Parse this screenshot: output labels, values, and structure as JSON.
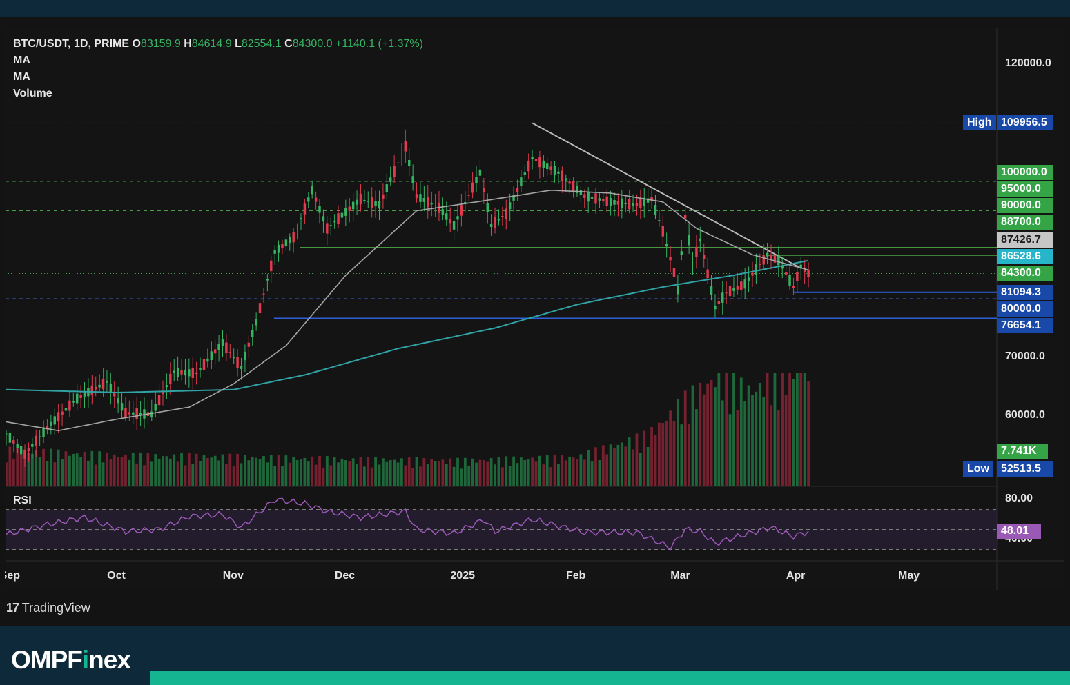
{
  "header": {
    "symbol": "BTC/USDT, 1D, PRIME",
    "o_key": "O",
    "o": "83159.9",
    "h_key": "H",
    "h": "84614.9",
    "l_key": "L",
    "l": "82554.1",
    "c_key": "C",
    "c": "84300.0",
    "change": "+1140.1 (+1.37%)",
    "indicators": [
      "MA",
      "MA",
      "Volume"
    ]
  },
  "rsi_label": "RSI",
  "branding": {
    "tradingview": "TradingView",
    "site_pre": "OMPF",
    "site_i": "i",
    "site_post": "nex"
  },
  "colors": {
    "up": "#35b463",
    "down": "#e03a4e",
    "ma_short": "#a5a5a5",
    "ma_long": "#2fa3a5",
    "rsi": "#9b59b6",
    "accent": "#15b592"
  },
  "chart_data": {
    "type": "candlestick",
    "symbol": "BTC/USDT",
    "interval": "1D",
    "x_labels": [
      "Sep",
      "Oct",
      "Nov",
      "Dec",
      "2025",
      "Feb",
      "Mar",
      "Apr",
      "May"
    ],
    "price_axis_ticks": [
      "120000.0",
      "70000.0",
      "60000.0"
    ],
    "price_range": [
      49000,
      125000
    ],
    "price_tags": [
      {
        "label": "High",
        "value": "109956.5",
        "style": "blue"
      },
      {
        "label": "",
        "value": "100000.0",
        "style": "green"
      },
      {
        "label": "",
        "value": "95000.0",
        "style": "green"
      },
      {
        "label": "",
        "value": "90000.0",
        "style": "green"
      },
      {
        "label": "",
        "value": "88700.0",
        "style": "green"
      },
      {
        "label": "",
        "value": "87426.7",
        "style": "grey"
      },
      {
        "label": "",
        "value": "86528.6",
        "style": "cyan"
      },
      {
        "label": "",
        "value": "84300.0",
        "style": "green"
      },
      {
        "label": "",
        "value": "81094.3",
        "style": "blue"
      },
      {
        "label": "",
        "value": "80000.0",
        "style": "blue"
      },
      {
        "label": "",
        "value": "76654.1",
        "style": "blue"
      },
      {
        "label": "",
        "value": "7.741K",
        "style": "green"
      },
      {
        "label": "Low",
        "value": "52513.5",
        "style": "blue"
      }
    ],
    "levels": [
      {
        "value": 100000,
        "style": "dashed-green"
      },
      {
        "value": 95000,
        "style": "dashed-green"
      },
      {
        "value": 88700,
        "style": "solid-green"
      },
      {
        "value": 87426.7,
        "style": "solid-green"
      },
      {
        "value": 84300,
        "style": "dotted-green"
      },
      {
        "value": 81094.3,
        "style": "solid-blue"
      },
      {
        "value": 80000,
        "style": "dashed-blue"
      },
      {
        "value": 76654.1,
        "style": "solid-blue"
      },
      {
        "value": 109956.5,
        "style": "dotted-blue"
      }
    ],
    "trendline": {
      "from": [
        "2025-01-20",
        109956.5
      ],
      "to": [
        "2025-04-02",
        85200
      ]
    },
    "ohlc_anchors": [
      [
        "2024-09-01",
        57000
      ],
      [
        "2024-09-06",
        53500
      ],
      [
        "2024-09-12",
        58000
      ],
      [
        "2024-09-20",
        63000
      ],
      [
        "2024-09-28",
        65800
      ],
      [
        "2024-10-03",
        60500
      ],
      [
        "2024-10-10",
        60300
      ],
      [
        "2024-10-16",
        67500
      ],
      [
        "2024-10-22",
        67300
      ],
      [
        "2024-10-29",
        72500
      ],
      [
        "2024-11-03",
        68300
      ],
      [
        "2024-11-07",
        76000
      ],
      [
        "2024-11-12",
        88000
      ],
      [
        "2024-11-17",
        90500
      ],
      [
        "2024-11-22",
        98500
      ],
      [
        "2024-11-26",
        92000
      ],
      [
        "2024-12-05",
        97000
      ],
      [
        "2024-12-10",
        96000
      ],
      [
        "2024-12-17",
        106000
      ],
      [
        "2024-12-20",
        97500
      ],
      [
        "2024-12-26",
        95500
      ],
      [
        "2024-12-30",
        92500
      ],
      [
        "2025-01-06",
        101500
      ],
      [
        "2025-01-09",
        92500
      ],
      [
        "2025-01-13",
        94500
      ],
      [
        "2025-01-20",
        104000
      ],
      [
        "2025-01-27",
        101500
      ],
      [
        "2025-02-03",
        97500
      ],
      [
        "2025-02-10",
        96500
      ],
      [
        "2025-02-17",
        96000
      ],
      [
        "2025-02-21",
        97000
      ],
      [
        "2025-02-24",
        91500
      ],
      [
        "2025-02-27",
        84500
      ],
      [
        "2025-02-28",
        81500
      ],
      [
        "2025-03-02",
        94000
      ],
      [
        "2025-03-04",
        86000
      ],
      [
        "2025-03-06",
        90000
      ],
      [
        "2025-03-10",
        78500
      ],
      [
        "2025-03-13",
        81000
      ],
      [
        "2025-03-18",
        82500
      ],
      [
        "2025-03-24",
        87500
      ],
      [
        "2025-03-27",
        86500
      ],
      [
        "2025-03-31",
        82000
      ],
      [
        "2025-04-02",
        85500
      ],
      [
        "2025-04-04",
        84300
      ]
    ],
    "ma_short_anchors": [
      [
        "2024-09-01",
        59000
      ],
      [
        "2024-09-15",
        57500
      ],
      [
        "2024-10-01",
        59500
      ],
      [
        "2024-10-20",
        61500
      ],
      [
        "2024-11-01",
        65500
      ],
      [
        "2024-11-15",
        72000
      ],
      [
        "2024-12-01",
        84000
      ],
      [
        "2024-12-20",
        95000
      ],
      [
        "2025-01-05",
        96500
      ],
      [
        "2025-01-25",
        98500
      ],
      [
        "2025-02-10",
        98000
      ],
      [
        "2025-02-24",
        96500
      ],
      [
        "2025-03-05",
        92000
      ],
      [
        "2025-03-20",
        87500
      ],
      [
        "2025-04-04",
        84900
      ]
    ],
    "ma_long_anchors": [
      [
        "2024-09-01",
        64500
      ],
      [
        "2024-10-01",
        64000
      ],
      [
        "2024-11-01",
        64500
      ],
      [
        "2024-11-20",
        67000
      ],
      [
        "2024-12-15",
        71500
      ],
      [
        "2025-01-10",
        75000
      ],
      [
        "2025-02-01",
        79000
      ],
      [
        "2025-02-24",
        82000
      ],
      [
        "2025-03-15",
        84000
      ],
      [
        "2025-04-04",
        86500
      ]
    ],
    "volume": {
      "last": "7.741K",
      "scale_max": 10000,
      "anchors": [
        [
          "2024-09-01",
          2800
        ],
        [
          "2024-10-01",
          2400
        ],
        [
          "2024-11-01",
          2300
        ],
        [
          "2024-12-01",
          2100
        ],
        [
          "2025-01-01",
          2000
        ],
        [
          "2025-02-01",
          2300
        ],
        [
          "2025-02-20",
          4000
        ],
        [
          "2025-03-01",
          6500
        ],
        [
          "2025-03-10",
          8500
        ],
        [
          "2025-03-20",
          7500
        ],
        [
          "2025-04-03",
          9800
        ],
        [
          "2025-04-04",
          7741
        ]
      ]
    },
    "rsi": {
      "last": "48.01",
      "axis_ticks": [
        "80.00",
        "40.00"
      ],
      "range": [
        20,
        80
      ],
      "band": [
        30,
        70
      ],
      "anchors": [
        [
          "2024-09-01",
          45
        ],
        [
          "2024-09-12",
          55
        ],
        [
          "2024-09-22",
          62
        ],
        [
          "2024-10-03",
          48
        ],
        [
          "2024-10-12",
          50
        ],
        [
          "2024-10-20",
          63
        ],
        [
          "2024-10-29",
          65
        ],
        [
          "2024-11-03",
          52
        ],
        [
          "2024-11-12",
          80
        ],
        [
          "2024-11-20",
          76
        ],
        [
          "2024-11-26",
          68
        ],
        [
          "2024-12-05",
          62
        ],
        [
          "2024-12-17",
          68
        ],
        [
          "2024-12-20",
          50
        ],
        [
          "2024-12-30",
          46
        ],
        [
          "2025-01-07",
          60
        ],
        [
          "2025-01-10",
          48
        ],
        [
          "2025-01-20",
          60
        ],
        [
          "2025-02-03",
          47
        ],
        [
          "2025-02-17",
          47
        ],
        [
          "2025-02-26",
          32
        ],
        [
          "2025-03-02",
          50
        ],
        [
          "2025-03-06",
          48
        ],
        [
          "2025-03-10",
          36
        ],
        [
          "2025-03-18",
          45
        ],
        [
          "2025-03-25",
          52
        ],
        [
          "2025-03-31",
          43
        ],
        [
          "2025-04-04",
          48
        ]
      ]
    }
  }
}
